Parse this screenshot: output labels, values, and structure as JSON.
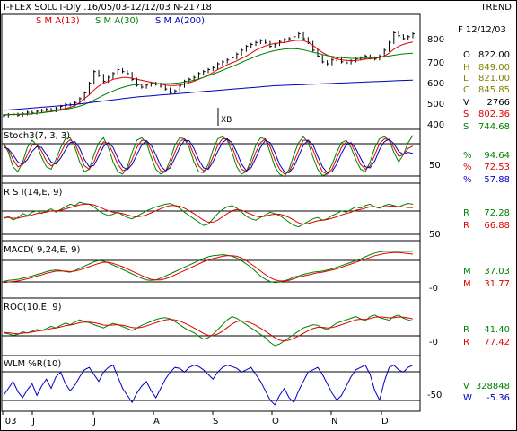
{
  "header": {
    "title": "I-FLEX SOLUT-Dly .16/05/03-12/12/03  N-21718",
    "trend": "TREND",
    "sma13": "S M A(13)",
    "sma30": "S M A(30)",
    "sma200": "S M A(200)",
    "date": "F 12/12/03"
  },
  "colors": {
    "price": "#000000",
    "sma13": "#e00000",
    "sma30": "#008000",
    "sma200": "#0000c0",
    "k_line": "#e00000",
    "d_line": "#0000c0",
    "stoch_green": "#008000",
    "wlm": "#0000c0"
  },
  "price_panel": {
    "axis_ticks": [
      "800",
      "700",
      "600",
      "500",
      "400"
    ],
    "annotation": "XB",
    "values": [
      {
        "label": "O",
        "value": "822.00",
        "color": "#000000"
      },
      {
        "label": "H",
        "value": "849.00",
        "color": "#808000"
      },
      {
        "label": "L",
        "value": "821.00",
        "color": "#808000"
      },
      {
        "label": "C",
        "value": "845.85",
        "color": "#808000"
      },
      {
        "label": "V",
        "value": "2766",
        "color": "#000000"
      },
      {
        "label": "S",
        "value": "802.36",
        "color": "#e00000"
      },
      {
        "label": "S",
        "value": "744.68",
        "color": "#008000"
      }
    ]
  },
  "stoch_panel": {
    "title": "Stoch3(7, 3, 3)",
    "tick": "50",
    "values": [
      {
        "label": "%",
        "value": "94.64",
        "color": "#008000"
      },
      {
        "label": "%",
        "value": "72.53",
        "color": "#e00000"
      },
      {
        "label": "%",
        "value": "57.88",
        "color": "#0000c0"
      }
    ]
  },
  "rsi_panel": {
    "title": "R S I(14,E, 9)",
    "tick": "50",
    "values": [
      {
        "label": "R",
        "value": "72.28",
        "color": "#008000"
      },
      {
        "label": "R",
        "value": "66.88",
        "color": "#e00000"
      }
    ]
  },
  "macd_panel": {
    "title": "MACD( 9,24,E, 9)",
    "tick": "-0",
    "values": [
      {
        "label": "M",
        "value": "37.03",
        "color": "#008000"
      },
      {
        "label": "M",
        "value": "31.77",
        "color": "#e00000"
      }
    ]
  },
  "roc_panel": {
    "title": "ROC(10,E, 9)",
    "tick": "-0",
    "values": [
      {
        "label": "R",
        "value": "41.40",
        "color": "#008000"
      },
      {
        "label": "R",
        "value": "77.42",
        "color": "#e00000"
      }
    ]
  },
  "wlm_panel": {
    "title": "WLM %R(10)",
    "tick": "-50",
    "values": [
      {
        "label": "V",
        "value": "328848",
        "color": "#008000"
      },
      {
        "label": "W",
        "value": "-5.36",
        "color": "#0000c0"
      }
    ]
  },
  "chart_data": {
    "type": "line",
    "x_axis_labels": [
      "'03",
      "J",
      "J",
      "A",
      "S",
      "O",
      "N",
      "D"
    ],
    "price": {
      "ylim": [
        380,
        880
      ],
      "close": [
        422,
        428,
        430,
        425,
        432,
        440,
        436,
        445,
        450,
        455,
        448,
        460,
        470,
        480,
        478,
        490,
        510,
        540,
        590,
        650,
        630,
        600,
        620,
        640,
        660,
        650,
        640,
        610,
        580,
        570,
        580,
        590,
        585,
        575,
        560,
        540,
        550,
        575,
        600,
        610,
        620,
        640,
        650,
        660,
        670,
        690,
        700,
        710,
        720,
        740,
        760,
        780,
        790,
        800,
        810,
        800,
        780,
        790,
        805,
        815,
        820,
        830,
        845,
        820,
        800,
        760,
        730,
        700,
        690,
        710,
        720,
        700,
        695,
        705,
        715,
        720,
        730,
        720,
        715,
        730,
        760,
        800,
        850,
        835,
        820,
        830,
        845
      ],
      "sma13": [
        425,
        427,
        428,
        428,
        429,
        430,
        432,
        435,
        438,
        442,
        446,
        450,
        455,
        460,
        465,
        475,
        490,
        510,
        530,
        555,
        575,
        590,
        600,
        610,
        615,
        620,
        620,
        615,
        610,
        605,
        600,
        595,
        590,
        585,
        580,
        578,
        578,
        580,
        585,
        592,
        600,
        610,
        620,
        632,
        645,
        660,
        672,
        685,
        695,
        705,
        718,
        730,
        745,
        760,
        772,
        782,
        790,
        795,
        798,
        800,
        805,
        810,
        812,
        810,
        800,
        785,
        765,
        748,
        735,
        722,
        715,
        710,
        708,
        706,
        707,
        710,
        714,
        716,
        718,
        722,
        730,
        745,
        765,
        780,
        790,
        797,
        802
      ],
      "sma30": [
        428,
        428,
        429,
        430,
        431,
        432,
        433,
        435,
        437,
        440,
        443,
        447,
        451,
        455,
        460,
        465,
        472,
        480,
        490,
        502,
        515,
        528,
        540,
        550,
        560,
        568,
        575,
        580,
        583,
        585,
        586,
        587,
        588,
        588,
        588,
        588,
        590,
        592,
        596,
        600,
        605,
        612,
        620,
        628,
        637,
        646,
        656,
        666,
        676,
        686,
        697,
        708,
        718,
        728,
        737,
        745,
        752,
        758,
        762,
        766,
        768,
        768,
        766,
        762,
        756,
        750,
        744,
        738,
        732,
        728,
        724,
        722,
        720,
        718,
        718,
        718,
        719,
        720,
        722,
        724,
        727,
        730,
        734,
        738,
        741,
        743,
        745
      ],
      "sma200": [
        450,
        452,
        454,
        456,
        458,
        460,
        462,
        464,
        466,
        468,
        470,
        472,
        474,
        476,
        478,
        480,
        483,
        486,
        489,
        492,
        495,
        498,
        501,
        504,
        507,
        510,
        513,
        516,
        519,
        521,
        523,
        525,
        527,
        529,
        531,
        533,
        535,
        537,
        539,
        541,
        543,
        545,
        547,
        549,
        551,
        553,
        555,
        557,
        559,
        561,
        563,
        565,
        567,
        569,
        571,
        573,
        575,
        577,
        578,
        579,
        580,
        581,
        582,
        583,
        584,
        585,
        586,
        587,
        588,
        589,
        590,
        591,
        592,
        593,
        594,
        595,
        596,
        597,
        598,
        599,
        600,
        601,
        602,
        603,
        604,
        605,
        606
      ]
    },
    "stoch": {
      "ylim": [
        0,
        100
      ],
      "reference_lines": [
        20,
        80
      ],
      "fast": [
        80,
        60,
        30,
        20,
        40,
        70,
        85,
        75,
        50,
        30,
        25,
        45,
        70,
        88,
        90,
        70,
        40,
        20,
        25,
        55,
        80,
        90,
        70,
        40,
        20,
        15,
        30,
        60,
        85,
        90,
        80,
        50,
        25,
        15,
        20,
        45,
        75,
        90,
        88,
        70,
        40,
        20,
        18,
        35,
        65,
        88,
        92,
        85,
        60,
        30,
        15,
        20,
        45,
        75,
        90,
        88,
        60,
        30,
        15,
        10,
        25,
        55,
        80,
        92,
        80,
        50,
        25,
        12,
        15,
        35,
        60,
        80,
        85,
        70,
        45,
        25,
        20,
        40,
        70,
        88,
        92,
        85,
        60,
        40,
        55,
        80,
        95
      ],
      "k": [
        75,
        65,
        45,
        30,
        35,
        55,
        75,
        78,
        62,
        42,
        32,
        38,
        58,
        78,
        86,
        78,
        55,
        32,
        25,
        40,
        65,
        82,
        78,
        58,
        35,
        22,
        25,
        45,
        70,
        85,
        84,
        65,
        40,
        22,
        20,
        35,
        60,
        82,
        88,
        78,
        55,
        32,
        22,
        28,
        50,
        75,
        88,
        88,
        72,
        45,
        25,
        20,
        35,
        60,
        80,
        88,
        72,
        45,
        25,
        15,
        20,
        40,
        65,
        85,
        85,
        65,
        40,
        20,
        15,
        25,
        48,
        70,
        82,
        78,
        58,
        35,
        25,
        32,
        55,
        78,
        88,
        86,
        70,
        52,
        55,
        68,
        73
      ],
      "d": [
        70,
        67,
        55,
        40,
        35,
        45,
        62,
        72,
        70,
        55,
        40,
        36,
        48,
        65,
        80,
        82,
        68,
        45,
        30,
        33,
        52,
        72,
        80,
        70,
        48,
        30,
        24,
        35,
        55,
        75,
        84,
        75,
        55,
        32,
        22,
        28,
        48,
        70,
        85,
        84,
        68,
        45,
        28,
        25,
        40,
        62,
        80,
        88,
        80,
        60,
        36,
        22,
        28,
        48,
        70,
        85,
        80,
        60,
        35,
        20,
        18,
        30,
        52,
        75,
        85,
        76,
        52,
        30,
        18,
        20,
        36,
        58,
        76,
        80,
        68,
        48,
        30,
        28,
        42,
        66,
        82,
        87,
        78,
        62,
        56,
        60,
        58
      ]
    },
    "rsi": {
      "ylim": [
        20,
        90
      ],
      "reference_lines": [
        40,
        70
      ],
      "rsi": [
        50,
        54,
        48,
        52,
        58,
        55,
        60,
        62,
        58,
        62,
        65,
        60,
        64,
        68,
        72,
        70,
        75,
        73,
        72,
        68,
        62,
        58,
        55,
        57,
        60,
        56,
        52,
        50,
        54,
        58,
        62,
        65,
        68,
        70,
        72,
        73,
        70,
        66,
        60,
        55,
        50,
        45,
        40,
        42,
        50,
        58,
        64,
        68,
        70,
        66,
        60,
        54,
        50,
        48,
        52,
        56,
        60,
        58,
        55,
        50,
        45,
        40,
        38,
        42,
        46,
        50,
        52,
        48,
        50,
        55,
        58,
        62,
        60,
        64,
        68,
        66,
        70,
        72,
        68,
        66,
        70,
        72,
        70,
        68,
        71,
        73,
        72
      ],
      "signal": [
        52,
        52,
        51,
        51,
        53,
        54,
        56,
        58,
        59,
        60,
        62,
        62,
        63,
        65,
        67,
        69,
        71,
        72,
        72,
        71,
        68,
        65,
        62,
        60,
        59,
        58,
        56,
        54,
        53,
        54,
        56,
        59,
        62,
        65,
        68,
        70,
        70,
        69,
        66,
        62,
        58,
        53,
        48,
        45,
        45,
        48,
        53,
        58,
        62,
        64,
        63,
        60,
        57,
        54,
        53,
        54,
        56,
        57,
        57,
        55,
        52,
        48,
        44,
        42,
        43,
        45,
        47,
        48,
        49,
        51,
        53,
        56,
        58,
        60,
        63,
        64,
        66,
        68,
        68,
        67,
        68,
        69,
        69,
        68,
        68,
        67,
        67
      ]
    },
    "macd": {
      "ylim": [
        -45,
        50
      ],
      "reference_lines": [
        0,
        25
      ],
      "macd": [
        -18,
        -16,
        -15,
        -14,
        -12,
        -10,
        -8,
        -5,
        -3,
        0,
        2,
        3,
        2,
        0,
        -1,
        2,
        6,
        10,
        14,
        18,
        20,
        19,
        16,
        12,
        8,
        4,
        0,
        -4,
        -8,
        -12,
        -15,
        -16,
        -15,
        -12,
        -8,
        -4,
        0,
        4,
        8,
        12,
        16,
        20,
        24,
        27,
        29,
        30,
        31,
        30,
        28,
        25,
        20,
        14,
        8,
        0,
        -8,
        -14,
        -18,
        -20,
        -19,
        -17,
        -14,
        -10,
        -8,
        -5,
        -3,
        -1,
        0,
        1,
        3,
        5,
        8,
        11,
        14,
        17,
        20,
        23,
        27,
        31,
        34,
        36,
        37,
        37,
        37,
        37,
        37,
        37,
        37
      ],
      "signal": [
        -20,
        -19,
        -18,
        -17,
        -15,
        -13,
        -11,
        -8,
        -6,
        -3,
        -1,
        1,
        1,
        1,
        0,
        1,
        3,
        6,
        9,
        12,
        15,
        17,
        17,
        15,
        12,
        9,
        5,
        1,
        -3,
        -7,
        -11,
        -14,
        -15,
        -15,
        -13,
        -10,
        -6,
        -2,
        2,
        6,
        10,
        14,
        18,
        21,
        24,
        26,
        28,
        29,
        29,
        28,
        25,
        20,
        14,
        8,
        1,
        -5,
        -11,
        -15,
        -17,
        -17,
        -16,
        -13,
        -10,
        -8,
        -6,
        -4,
        -2,
        -1,
        1,
        3,
        5,
        8,
        11,
        14,
        17,
        20,
        23,
        26,
        29,
        31,
        33,
        34,
        35,
        35,
        34,
        33,
        32
      ]
    },
    "roc": {
      "ylim": [
        -60,
        90
      ],
      "reference_lines": [
        0
      ],
      "roc": [
        5,
        2,
        -3,
        0,
        8,
        4,
        10,
        15,
        12,
        18,
        25,
        20,
        28,
        35,
        30,
        38,
        45,
        40,
        36,
        30,
        25,
        20,
        28,
        34,
        30,
        24,
        18,
        12,
        20,
        28,
        34,
        40,
        46,
        50,
        52,
        48,
        40,
        30,
        20,
        12,
        5,
        -5,
        -15,
        -10,
        0,
        15,
        30,
        45,
        55,
        50,
        40,
        30,
        20,
        10,
        0,
        -10,
        -25,
        -35,
        -30,
        -20,
        -10,
        0,
        10,
        20,
        25,
        30,
        28,
        20,
        15,
        25,
        35,
        40,
        45,
        50,
        55,
        48,
        42,
        55,
        60,
        52,
        48,
        44,
        55,
        60,
        50,
        45,
        41
      ],
      "signal": [
        6,
        5,
        3,
        2,
        4,
        5,
        7,
        10,
        12,
        14,
        18,
        20,
        23,
        27,
        29,
        32,
        36,
        38,
        38,
        36,
        33,
        29,
        28,
        29,
        30,
        28,
        25,
        21,
        20,
        22,
        26,
        31,
        36,
        41,
        45,
        47,
        45,
        41,
        35,
        28,
        20,
        12,
        3,
        -3,
        -4,
        1,
        10,
        21,
        32,
        40,
        42,
        40,
        35,
        28,
        19,
        10,
        0,
        -10,
        -18,
        -20,
        -18,
        -12,
        -5,
        3,
        11,
        18,
        22,
        22,
        20,
        21,
        25,
        30,
        35,
        40,
        45,
        47,
        46,
        49,
        53,
        54,
        53,
        51,
        52,
        54,
        53,
        51,
        48
      ]
    },
    "wlm_r": {
      "ylim": [
        -100,
        0
      ],
      "reference_lines": [
        -20,
        -80
      ],
      "values": [
        -70,
        -55,
        -40,
        -62,
        -75,
        -58,
        -45,
        -70,
        -50,
        -35,
        -55,
        -30,
        -20,
        -45,
        -60,
        -48,
        -30,
        -15,
        -10,
        -25,
        -40,
        -20,
        -10,
        -5,
        -30,
        -55,
        -70,
        -85,
        -65,
        -50,
        -40,
        -60,
        -75,
        -55,
        -35,
        -20,
        -10,
        -12,
        -20,
        -10,
        -5,
        -8,
        -15,
        -25,
        -35,
        -20,
        -10,
        -5,
        -8,
        -12,
        -20,
        -15,
        -10,
        -25,
        -40,
        -60,
        -80,
        -90,
        -70,
        -55,
        -75,
        -85,
        -60,
        -40,
        -20,
        -15,
        -10,
        -25,
        -45,
        -65,
        -80,
        -70,
        -50,
        -30,
        -15,
        -10,
        -5,
        -25,
        -60,
        -80,
        -40,
        -10,
        -5,
        -15,
        -20,
        -10,
        -5
      ]
    }
  }
}
